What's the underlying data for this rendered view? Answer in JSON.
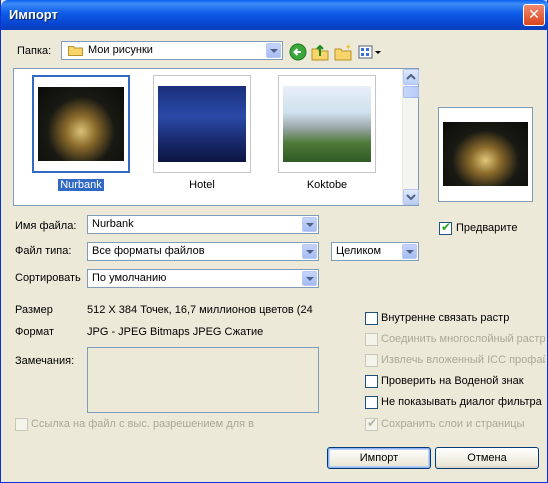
{
  "window": {
    "title": "Импорт",
    "close": "✕"
  },
  "folder": {
    "label": "Папка:",
    "value": "Мои рисунки"
  },
  "toolbar": {
    "back_icon": "back-arrow-icon",
    "up_icon": "up-folder-icon",
    "new_folder_icon": "new-folder-icon",
    "view_icon": "view-menu-icon"
  },
  "thumbnails": [
    {
      "label": "Nurbank",
      "selected": true
    },
    {
      "label": "Hotel",
      "selected": false
    },
    {
      "label": "Koktobe",
      "selected": false
    }
  ],
  "preview_checkbox": {
    "label": "Предварите",
    "checked": true
  },
  "filename": {
    "label": "Имя файла:",
    "value": "Nurbank"
  },
  "filetype": {
    "label": "Файл типа:",
    "value": "Все форматы файлов"
  },
  "whole": {
    "value": "Целиком"
  },
  "sort": {
    "label": "Сортировать",
    "value": "По умолчанию"
  },
  "info": {
    "size_label": "Размер",
    "size_value": "512 X 384 Точек, 16,7 миллионов цветов (24",
    "format_label": "Формат",
    "format_value": "JPG - JPEG Bitmaps JPEG Сжатие",
    "notes_label": "Замечания:"
  },
  "options": [
    {
      "label": "Внутренне связать растр",
      "checked": false,
      "disabled": false
    },
    {
      "label": "Соединить многослойный растр",
      "checked": false,
      "disabled": true
    },
    {
      "label": "Извлечь вложенный ICC профайл",
      "checked": false,
      "disabled": true
    },
    {
      "label": "Проверить на Воденой знак",
      "checked": false,
      "disabled": false
    },
    {
      "label": "Не показывать диалог фильтра",
      "checked": false,
      "disabled": false
    },
    {
      "label": "Сохранить слои и страницы",
      "checked": true,
      "disabled": true
    }
  ],
  "link_option": {
    "label": "Ссылка на файл с выс. разрешением для в",
    "checked": false,
    "disabled": true
  },
  "buttons": {
    "import": "Импорт",
    "cancel": "Отмена"
  }
}
